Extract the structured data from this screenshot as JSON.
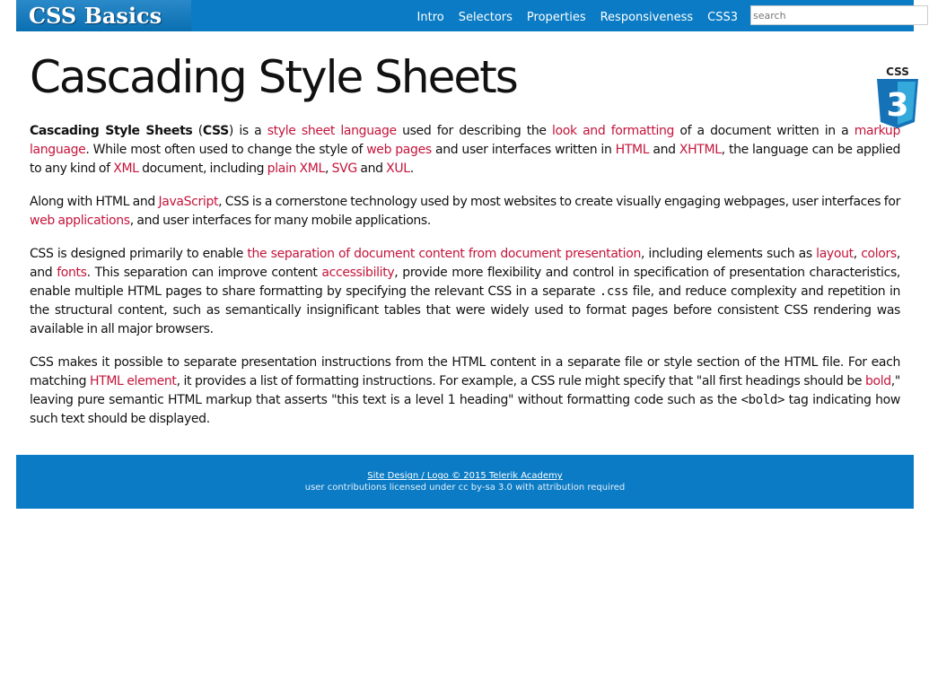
{
  "header": {
    "logo": "CSS Basics",
    "nav": [
      "Intro",
      "Selectors",
      "Properties",
      "Responsiveness",
      "CSS3"
    ],
    "search_placeholder": "search"
  },
  "main": {
    "title": "Cascading Style Sheets",
    "badge_label": "CSS",
    "badge_number": "3",
    "paragraphs": [
      [
        {
          "b": "Cascading Style Sheets"
        },
        {
          "t": " ("
        },
        {
          "b": "CSS"
        },
        {
          "t": ") is a "
        },
        {
          "a": "style sheet language"
        },
        {
          "t": " used for describing the "
        },
        {
          "a": "look and formatting"
        },
        {
          "t": " of a document written in a "
        },
        {
          "a": "markup language"
        },
        {
          "t": ". While most often used to change the style of "
        },
        {
          "a": "web pages"
        },
        {
          "t": " and user interfaces written in "
        },
        {
          "a": "HTML"
        },
        {
          "t": " and "
        },
        {
          "a": "XHTML"
        },
        {
          "t": ", the language can be applied to any kind of "
        },
        {
          "a": "XML"
        },
        {
          "t": " document, including "
        },
        {
          "a": "plain XML"
        },
        {
          "t": ", "
        },
        {
          "a": "SVG"
        },
        {
          "t": " and "
        },
        {
          "a": "XUL"
        },
        {
          "t": "."
        }
      ],
      [
        {
          "t": "Along with HTML and "
        },
        {
          "a": "JavaScript"
        },
        {
          "t": ", CSS is a cornerstone technology used by most websites to create visually engaging webpages, user interfaces for "
        },
        {
          "a": "web applications"
        },
        {
          "t": ", and user interfaces for many mobile applications."
        }
      ],
      [
        {
          "t": "CSS is designed primarily to enable "
        },
        {
          "a": "the separation of document content from document presentation"
        },
        {
          "t": ", including elements such as "
        },
        {
          "a": "layout"
        },
        {
          "t": ", "
        },
        {
          "a": "colors"
        },
        {
          "t": ", and "
        },
        {
          "a": "fonts"
        },
        {
          "t": ". This separation can improve content "
        },
        {
          "a": "accessibility"
        },
        {
          "t": ", provide more flexibility and control in specification of presentation characteristics, enable multiple HTML pages to share formatting by specifying the relevant CSS in a separate "
        },
        {
          "c": ".css"
        },
        {
          "t": " file, and reduce complexity and repetition in the structural content, such as semantically insignificant tables that were widely used to format pages before consistent CSS rendering was available in all major browsers."
        }
      ],
      [
        {
          "t": "CSS makes it possible to separate presentation instructions from the HTML content in a separate file or style section of the HTML file. For each matching "
        },
        {
          "a": "HTML element"
        },
        {
          "t": ", it provides a list of formatting instructions. For example, a CSS rule might specify that \"all first headings should be "
        },
        {
          "a": "bold"
        },
        {
          "t": ",\" leaving pure semantic HTML markup that asserts \"this text is a level 1 heading\" without formatting code such as the "
        },
        {
          "c": "<bold>"
        },
        {
          "t": " tag indicating how such text should be displayed."
        }
      ]
    ]
  },
  "footer": {
    "credit_link": "Site Design / Logo © 2015 Telerik Academy",
    "license": "user contributions licensed under cc by-sa 3.0 with attribution required"
  },
  "colors": {
    "brand_blue": "#0a7bc4",
    "link_red": "#c4153b"
  }
}
